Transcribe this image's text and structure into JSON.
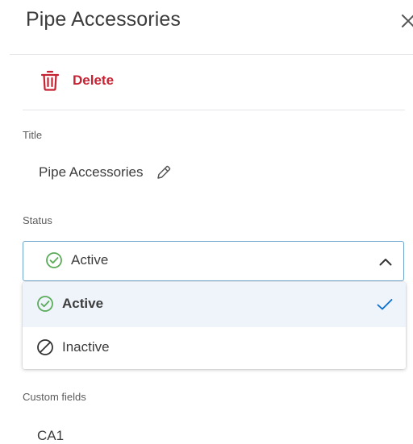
{
  "panel": {
    "title": "Pipe Accessories",
    "close_icon": "close-icon",
    "delete_label": "Delete",
    "delete_icon": "trash-icon"
  },
  "fields": {
    "title_label": "Title",
    "title_value": "Pipe Accessories",
    "edit_icon": "pencil-icon",
    "status_label": "Status",
    "status_value": "Active",
    "custom_fields_label": "Custom fields",
    "custom_field_value": "CA1"
  },
  "status_dropdown": {
    "expanded": true,
    "options": [
      {
        "label": "Active",
        "icon": "check-circle-icon",
        "selected": true
      },
      {
        "label": "Inactive",
        "icon": "forbidden-icon",
        "selected": false
      }
    ]
  },
  "colors": {
    "delete_red": "#c52233",
    "active_green": "#5aab5a",
    "accent_blue": "#0a6fd0",
    "focus_border": "#6ea6cf",
    "selected_bg": "#eef4fa"
  }
}
